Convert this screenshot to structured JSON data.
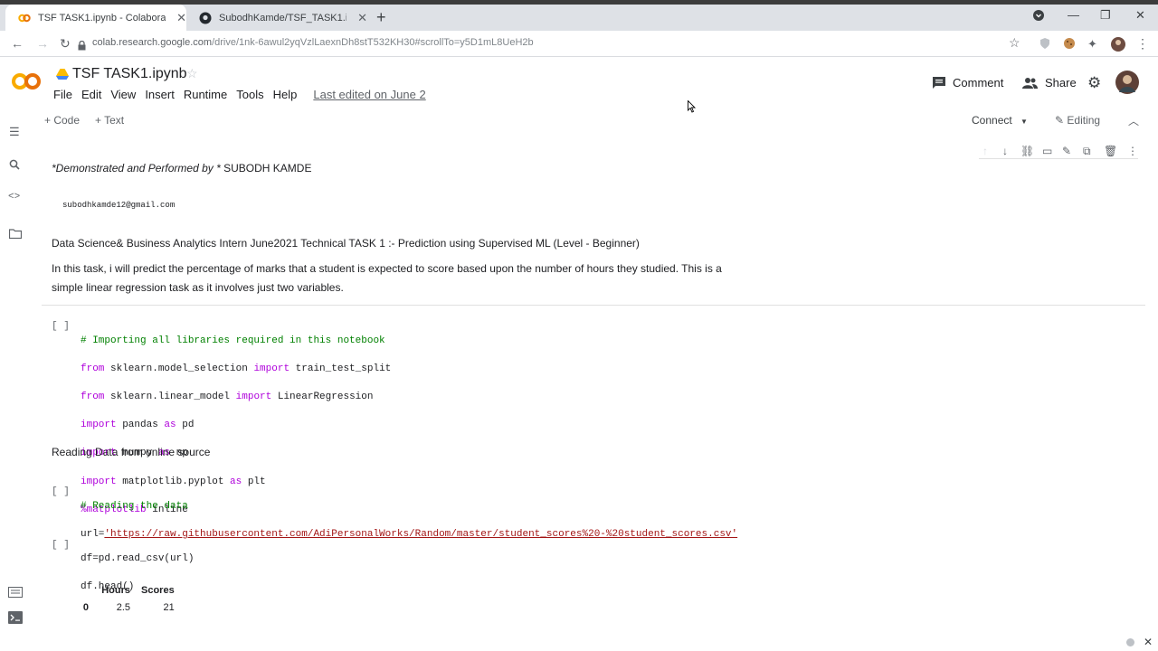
{
  "browser": {
    "tabs": [
      {
        "title": "TSF TASK1.ipynb - Colaboratory",
        "icon": "colab-icon",
        "active": true
      },
      {
        "title": "SubodhKamde/TSF_TASK1.ipynb",
        "icon": "github-icon",
        "active": false
      }
    ],
    "new_tab": "+",
    "url_domain": "colab.research.google.com",
    "url_path": "/drive/1nk-6awul2yqVzlLaexnDh8stT532KH30#scrollTo=y5D1mL8UeH2b"
  },
  "colab": {
    "logo": "CO",
    "file_name": "TSF TASK1.ipynb",
    "menu": [
      "File",
      "Edit",
      "View",
      "Insert",
      "Runtime",
      "Tools",
      "Help"
    ],
    "last_edited": "Last edited on June 2",
    "comment_label": "Comment",
    "share_label": "Share",
    "add_code": "+ Code",
    "add_text": "+ Text",
    "connect_label": "Connect",
    "editing_label": "Editing"
  },
  "text_cell": {
    "author_prefix": "*Demonstrated and Performed by *",
    "author_name": " SUBODH KAMDE",
    "email": "subodhkamde12@gmail.com",
    "heading": "Data Science& Business Analytics Intern June2021 Technical TASK 1 :- Prediction using Supervised ML (Level - Beginner)",
    "para_line1": "In this task, i will predict the percentage of marks that a student is expected to score based upon the number of hours they studied. This is a",
    "para_line2": "simple linear regression task as it involves just two variables."
  },
  "code_cell_1": {
    "run_indicator": "[ ]",
    "comment": "# Importing all libraries required in this notebook",
    "l2a": "from",
    "l2b": " sklearn.model_selection ",
    "l2c": "import",
    "l2d": " train_test_split",
    "l3a": "from",
    "l3b": " sklearn.linear_model ",
    "l3c": "import",
    "l3d": " LinearRegression",
    "l4a": "import",
    "l4b": " pandas ",
    "l4c": "as",
    "l4d": " pd",
    "l5a": "import",
    "l5b": " numpy ",
    "l5c": "as",
    "l5d": " np",
    "l6a": "import",
    "l6b": " matplotlib.pyplot ",
    "l6c": "as",
    "l6d": " plt",
    "l7a": "%matplotlib",
    "l7b": " inline"
  },
  "md_reading": "Reading Data from online source",
  "code_cell_2": {
    "run_indicator": "[ ]",
    "comment": "# Reading the data",
    "url_prefix": "url=",
    "url_value": "'https://raw.githubusercontent.com/AdiPersonalWorks/Random/master/student_scores%20-%20student_scores.csv'"
  },
  "code_cell_3": {
    "run_indicator": "[ ]",
    "line1": "df=pd.read_csv(url)",
    "line2": "df.head()"
  },
  "output_table": {
    "columns": [
      "",
      "Hours",
      "Scores"
    ],
    "rows": [
      [
        "0",
        "2.5",
        "21"
      ]
    ]
  }
}
